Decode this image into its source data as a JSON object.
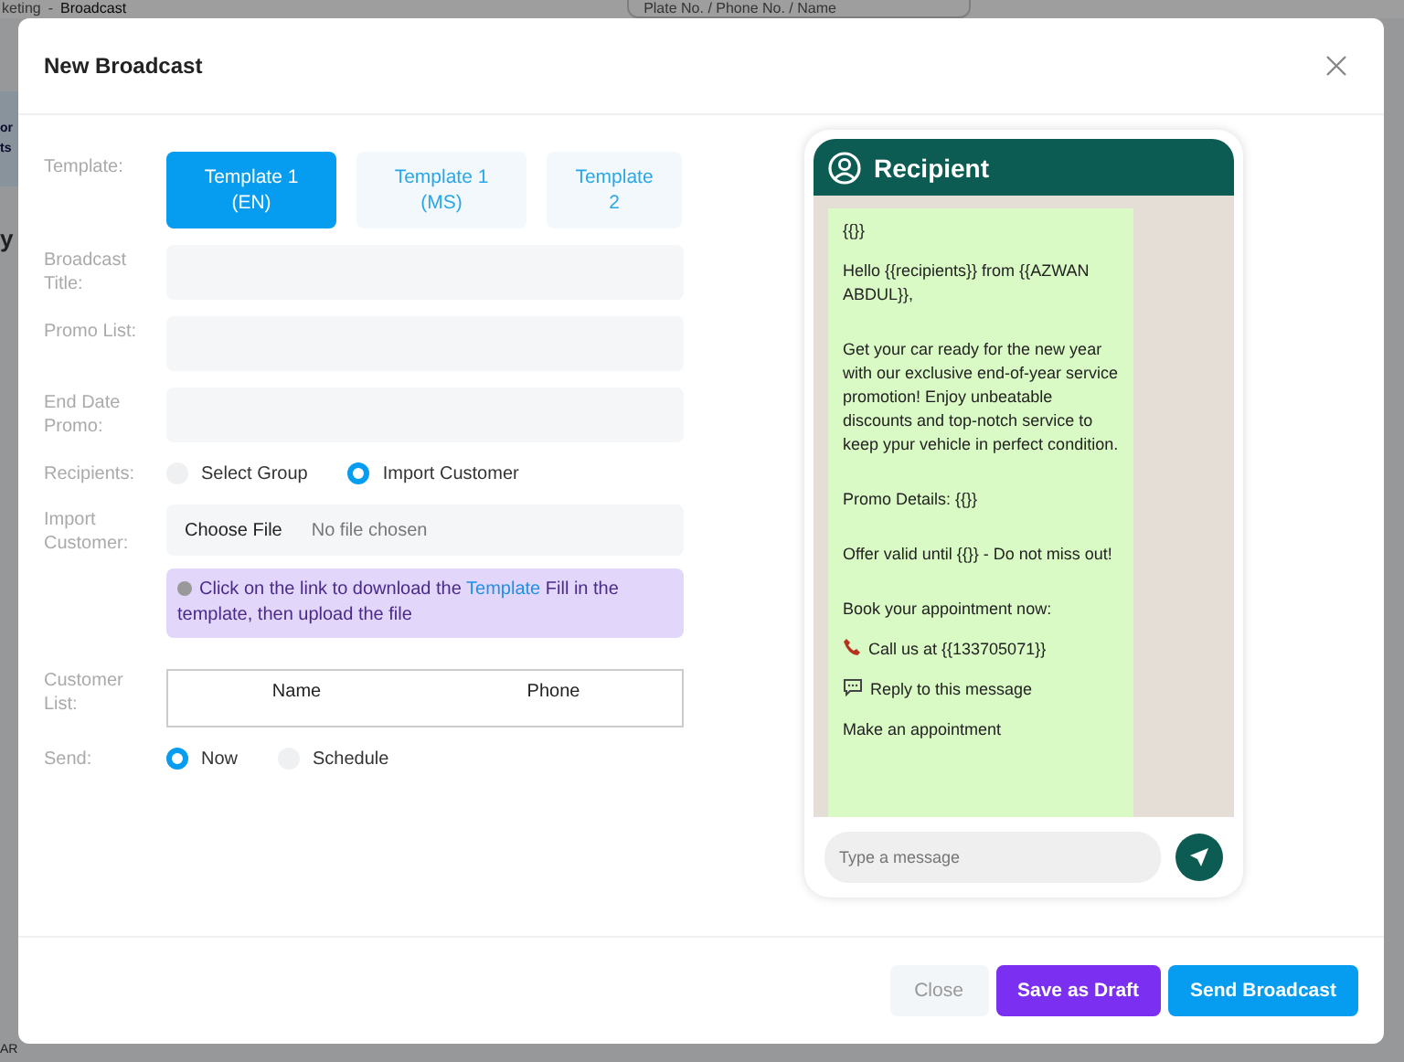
{
  "background": {
    "breadcrumb": [
      "keting",
      "Broadcast"
    ],
    "separator": "-",
    "card_lines": [
      "or",
      "ts"
    ],
    "heading": "y",
    "footer_text": "AR",
    "search": {
      "placeholder": "Plate No. / Phone No. / Name"
    }
  },
  "dialog": {
    "title": "New Broadcast"
  },
  "template": {
    "label": "Template:",
    "options": [
      {
        "label": "Template 1 (EN)",
        "selected": true
      },
      {
        "label": "Template 1 (MS)",
        "selected": false
      },
      {
        "label": "Template 2",
        "selected": false
      }
    ]
  },
  "fields": [
    {
      "kind": "text",
      "label": "Broadcast Title:"
    },
    {
      "kind": "text",
      "label": "Promo List:"
    },
    {
      "kind": "text",
      "label": "End Date Promo:"
    },
    {
      "kind": "radio",
      "label": "Recipients:",
      "options": [
        {
          "label": "Select Group",
          "selected": false
        },
        {
          "label": "Import Customer",
          "selected": true
        }
      ]
    },
    {
      "kind": "file",
      "label": "Import Customer:",
      "button": "Choose File",
      "status": "No file chosen",
      "note_before": "Click on the link to download the",
      "link": "Template",
      "note_after": "Fill in the template, then upload the file"
    },
    {
      "kind": "table",
      "label": "Customer List:",
      "columns": [
        "Name",
        "Phone"
      ]
    },
    {
      "kind": "radio",
      "label": "Send:",
      "options": [
        {
          "label": "Now",
          "selected": true
        },
        {
          "label": "Schedule",
          "selected": false
        }
      ]
    }
  ],
  "preview": {
    "title": "Recipient",
    "messages": [
      {
        "kind": "text",
        "text": "{{}}"
      },
      {
        "kind": "text",
        "text": "Hello {{recipients}} from {{AZWAN ABDUL}},"
      },
      {
        "kind": "text",
        "text": "Get your car ready for the new year with our exclusive end-of-year service promotion! Enjoy unbeatable discounts and top-notch service to keep ypur vehicle in perfect condition."
      },
      {
        "kind": "text",
        "text": "Promo Details: {{}}"
      },
      {
        "kind": "text",
        "text": "Offer valid until {{}} - Do not miss out!"
      },
      {
        "kind": "text",
        "text": "Book your appointment now:"
      },
      {
        "kind": "call",
        "text": "Call us at {{133705071}}"
      },
      {
        "kind": "reply",
        "text": "Reply to this message"
      },
      {
        "kind": "text",
        "text": "Make an appointment"
      }
    ],
    "input": {
      "placeholder": "Type a message"
    }
  },
  "buttons": [
    {
      "kind": "plain",
      "label": "Close"
    },
    {
      "kind": "draft",
      "label": "Save as Draft"
    },
    {
      "kind": "primary",
      "label": "Send Broadcast"
    }
  ]
}
